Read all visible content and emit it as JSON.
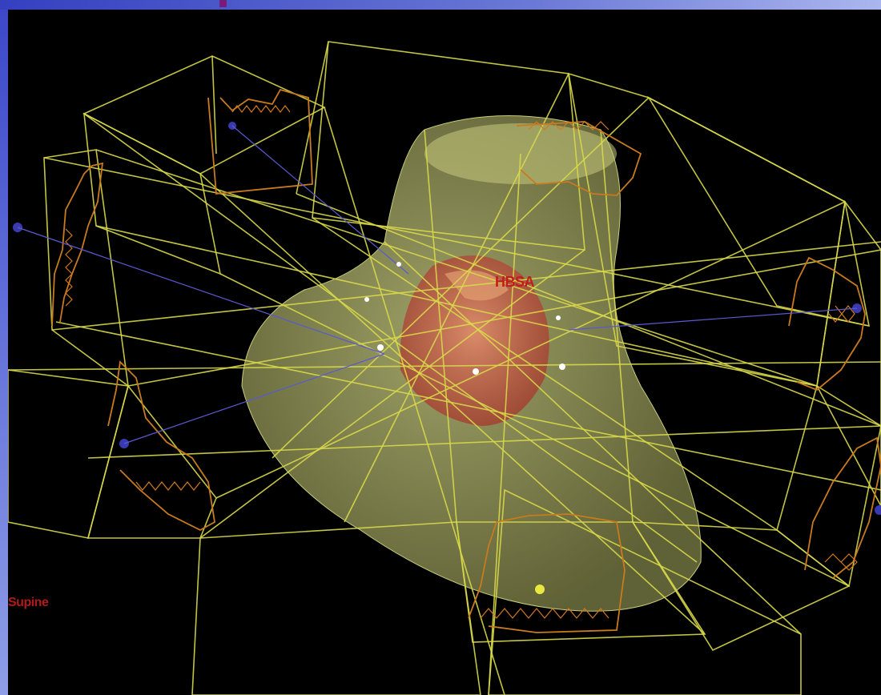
{
  "viewport": {
    "target_label": "HBSA",
    "orientation_label": "Supine",
    "colors": {
      "background": "#000000",
      "beam_lines": "#d8d84a",
      "collimator": "#c87a1e",
      "body_contour": "#b9bd6a",
      "target_volume": "#c2553a",
      "source_points": "#3a3ab0",
      "frame_border": "#4a55c8"
    },
    "icons": [
      "beam-wireframe",
      "mlc-aperture",
      "patient-body-surface",
      "tumor-volume",
      "beam-source-marker",
      "isocenter-point"
    ]
  }
}
